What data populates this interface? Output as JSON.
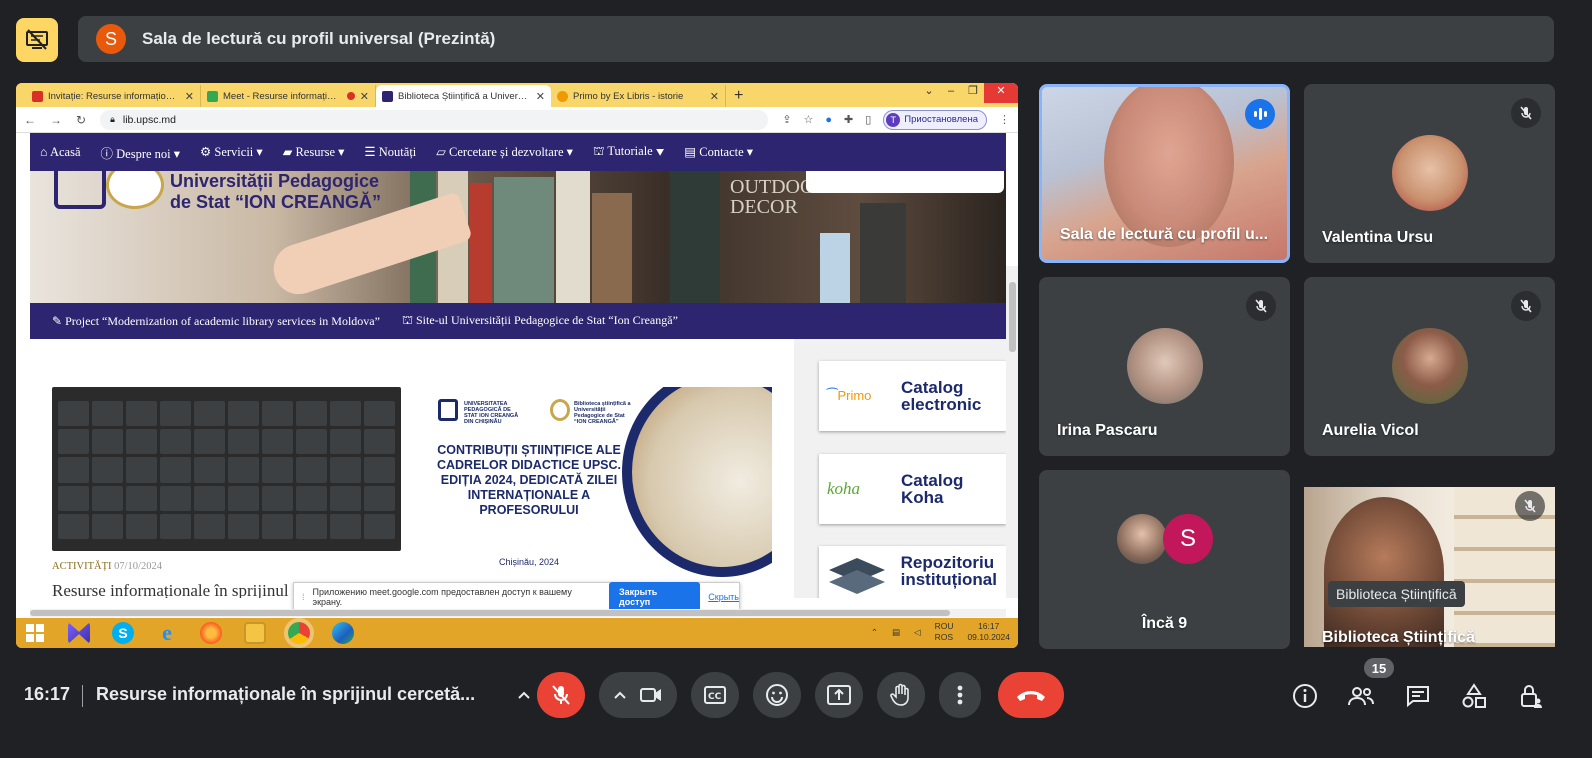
{
  "presenter": {
    "avatar_letter": "S",
    "avatar_color": "#e8590c",
    "title": "Sala de lectură cu profil universal (Prezintă)"
  },
  "browser": {
    "tabs": [
      {
        "label": "Invitație: Resurse informaționale",
        "icon": "gmail-icon",
        "color": "#d93025"
      },
      {
        "label": "Meet - Resurse informaționale",
        "icon": "meet-icon",
        "color": "#34a853"
      },
      {
        "label": "Biblioteca Științifică a Universității",
        "icon": "library-icon",
        "color": "#2e2570"
      },
      {
        "label": "Primo by Ex Libris - istorie",
        "icon": "primo-icon",
        "color": "#f29900"
      }
    ],
    "url": "lib.upsc.md",
    "profile_letter": "T",
    "profile_status": "Приостановлена"
  },
  "site": {
    "nav": [
      "Acasă",
      "Despre noi",
      "Servicii",
      "Resurse",
      "Noutăți",
      "Cercetare și dezvoltare",
      "Tutoriale",
      "Contacte"
    ],
    "banner_title_line1": "Universității Pedagogice",
    "banner_title_line2": "de Stat “ION CREANGĂ”",
    "banner_book_text_1": "OUTDOOR",
    "banner_book_text_2": "DECOR",
    "subnav": [
      "Project “Modernization of academic library services in Moldova”",
      "Site-ul Universității Pedagogice de Stat “Ion Creangă”"
    ],
    "poster": {
      "logo1_text": "UNIVERSITATEA PEDAGOGICĂ DE STAT ION CREANGĂ DIN CHIȘINĂU",
      "logo2_text": "Biblioteca științifică a Universității Pedagogice de Stat “ION CREANGĂ”",
      "headline": "CONTRIBUȚII ȘTIINȚIFICE ALE CADRELOR DIDACTICE UPSC. EDIȚIA 2024, DEDICATĂ ZILEI INTERNAȚIONALE A PROFESORULUI",
      "place_date": "Chișinău, 2024"
    },
    "article_category": "ACTIVITĂȚI",
    "article_date": "07/10/2024",
    "article_title": "Resurse informaționale în sprijinul",
    "cards": [
      {
        "brand": "Primo",
        "name": "Catalog electronic",
        "brand_color": "#f29900"
      },
      {
        "brand": "koha",
        "name": "Catalog Koha",
        "brand_color": "#5aa832"
      },
      {
        "brand": "",
        "name": "Repozitoriu instituțional",
        "brand_color": "#444"
      }
    ]
  },
  "share_toast": {
    "message": "Приложению meet.google.com предоставлен доступ к вашему экрану.",
    "stop_button": "Закрыть доступ",
    "hide_link": "Скрыть"
  },
  "taskbar": {
    "lang_1": "ROU",
    "lang_2": "ROS",
    "time": "16:17",
    "date": "09.10.2024"
  },
  "participants": [
    {
      "name": "Sala de lectură cu profil u...",
      "speaking": true
    },
    {
      "name": "Valentina Ursu",
      "muted": true
    },
    {
      "name": "Irina Pascaru",
      "muted": true
    },
    {
      "name": "Aurelia Vicol",
      "muted": true
    },
    {
      "name": "Încă 9",
      "avatar_letter": "S",
      "avatar_color": "#c2185b"
    },
    {
      "name": "Biblioteca Științifică",
      "tooltip": "Biblioteca Științifică",
      "muted": true
    }
  ],
  "bottom_bar": {
    "clock": "16:17",
    "meeting_title": "Resurse informaționale în sprijinul cercetă...",
    "people_count": "15"
  }
}
